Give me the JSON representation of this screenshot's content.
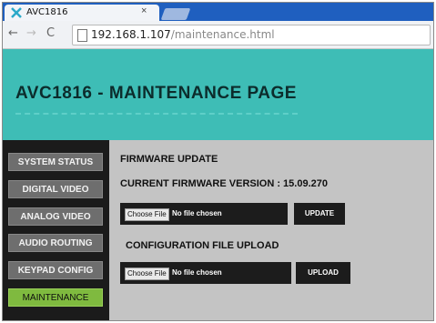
{
  "browser": {
    "tab_title": "AVC1816",
    "tab_close": "×",
    "url_host": "192.168.1.107",
    "url_path": "/maintenance.html"
  },
  "page": {
    "title": "AVC1816 - MAINTENANCE PAGE"
  },
  "sidebar": {
    "items": [
      {
        "label": "SYSTEM STATUS"
      },
      {
        "label": "DIGITAL VIDEO"
      },
      {
        "label": "ANALOG VIDEO"
      },
      {
        "label": "AUDIO ROUTING"
      },
      {
        "label": "KEYPAD CONFIG"
      },
      {
        "label": "MAINTENANCE",
        "active": true
      }
    ]
  },
  "firmware": {
    "heading": "FIRMWARE UPDATE",
    "current_version": "CURRENT FIRMWARE VERSION : 15.09.270",
    "choose_label": "Choose File",
    "no_file": "No file chosen",
    "button_label": "UPDATE"
  },
  "config": {
    "heading": "CONFIGURATION FILE UPLOAD",
    "choose_label": "Choose File",
    "no_file": "No file chosen",
    "button_label": "UPLOAD"
  },
  "colors": {
    "header_bg": "#3ebdb6",
    "active_nav": "#7fba3f",
    "content_bg": "#c4c4c4",
    "sidebar_bg": "#1b1b1b"
  }
}
